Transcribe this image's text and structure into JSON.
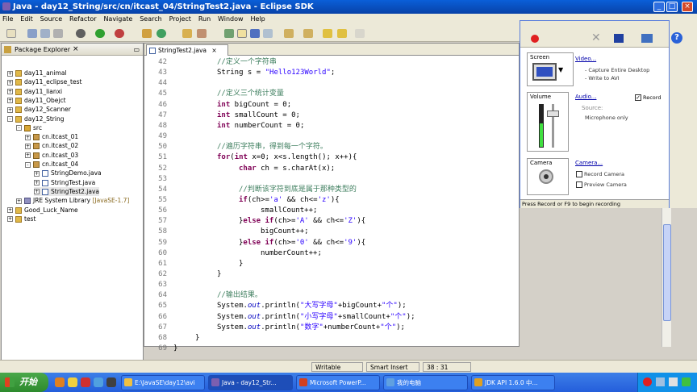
{
  "window": {
    "title": "Java - day12_String/src/cn/itcast_04/StringTest2.java - Eclipse SDK"
  },
  "menu": [
    "File",
    "Edit",
    "Source",
    "Refactor",
    "Navigate",
    "Search",
    "Project",
    "Run",
    "Window",
    "Help"
  ],
  "package_explorer": {
    "title": "Package Explorer",
    "items": [
      {
        "label": "day11_animal",
        "depth": 0,
        "exp": "+",
        "icon": "project"
      },
      {
        "label": "day11_eclipse_test",
        "depth": 0,
        "exp": "+",
        "icon": "project"
      },
      {
        "label": "day11_lianxi",
        "depth": 0,
        "exp": "+",
        "icon": "project"
      },
      {
        "label": "day11_Obejct",
        "depth": 0,
        "exp": "+",
        "icon": "project"
      },
      {
        "label": "day12_Scanner",
        "depth": 0,
        "exp": "+",
        "icon": "project"
      },
      {
        "label": "day12_String",
        "depth": 0,
        "exp": "-",
        "icon": "project"
      },
      {
        "label": "src",
        "depth": 1,
        "exp": "-",
        "icon": "src"
      },
      {
        "label": "cn.itcast_01",
        "depth": 2,
        "exp": "+",
        "icon": "package"
      },
      {
        "label": "cn.itcast_02",
        "depth": 2,
        "exp": "+",
        "icon": "package"
      },
      {
        "label": "cn.itcast_03",
        "depth": 2,
        "exp": "+",
        "icon": "package"
      },
      {
        "label": "cn.itcast_04",
        "depth": 2,
        "exp": "-",
        "icon": "package"
      },
      {
        "label": "StringDemo.java",
        "depth": 3,
        "exp": "+",
        "icon": "java"
      },
      {
        "label": "StringTest.java",
        "depth": 3,
        "exp": "+",
        "icon": "java"
      },
      {
        "label": "StringTest2.java",
        "depth": 3,
        "exp": "+",
        "icon": "java",
        "selected": true
      },
      {
        "label": "JRE System Library",
        "suffix": "[JavaSE-1.7]",
        "depth": 1,
        "exp": "+",
        "icon": "jre"
      },
      {
        "label": "Good_Luck_Name",
        "depth": 0,
        "exp": "+",
        "icon": "project"
      },
      {
        "label": "test",
        "depth": 0,
        "exp": "+",
        "icon": "project"
      }
    ]
  },
  "editor": {
    "tab": "StringTest2.java",
    "lines": [
      {
        "n": "42",
        "indent": 2,
        "parts": [
          [
            "cm",
            "//定义一个字符串"
          ]
        ]
      },
      {
        "n": "43",
        "indent": 2,
        "parts": [
          [
            "",
            "String s = "
          ],
          [
            "str",
            "\"Hello123World\""
          ],
          [
            "",
            ";"
          ]
        ]
      },
      {
        "n": "44",
        "indent": 0,
        "parts": []
      },
      {
        "n": "45",
        "indent": 2,
        "parts": [
          [
            "cm",
            "//定义三个统计变量"
          ]
        ]
      },
      {
        "n": "46",
        "indent": 2,
        "parts": [
          [
            "kw",
            "int"
          ],
          [
            "",
            " bigCount = 0;"
          ]
        ]
      },
      {
        "n": "47",
        "indent": 2,
        "parts": [
          [
            "kw",
            "int"
          ],
          [
            "",
            " smallCount = 0;"
          ]
        ]
      },
      {
        "n": "48",
        "indent": 2,
        "parts": [
          [
            "kw",
            "int"
          ],
          [
            "",
            " numberCount = 0;"
          ]
        ]
      },
      {
        "n": "49",
        "indent": 0,
        "parts": []
      },
      {
        "n": "50",
        "indent": 2,
        "parts": [
          [
            "cm",
            "//遍历字符串，得到每一个字符。"
          ]
        ]
      },
      {
        "n": "51",
        "indent": 2,
        "parts": [
          [
            "kw",
            "for"
          ],
          [
            "",
            "("
          ],
          [
            "kw",
            "int"
          ],
          [
            "",
            " x=0; x<s.length(); x++){"
          ]
        ]
      },
      {
        "n": "52",
        "indent": 3,
        "parts": [
          [
            "kw",
            "char"
          ],
          [
            "",
            " ch = s.charAt(x);"
          ]
        ]
      },
      {
        "n": "53",
        "indent": 0,
        "parts": []
      },
      {
        "n": "54",
        "indent": 3,
        "parts": [
          [
            "cm",
            "//判断该字符到底是属于那种类型的"
          ]
        ]
      },
      {
        "n": "55",
        "indent": 3,
        "parts": [
          [
            "kw",
            "if"
          ],
          [
            "",
            "(ch>="
          ],
          [
            "str",
            "'a'"
          ],
          [
            "",
            " && ch<="
          ],
          [
            "str",
            "'z'"
          ],
          [
            "",
            "){"
          ]
        ]
      },
      {
        "n": "56",
        "indent": 4,
        "parts": [
          [
            "",
            "smallCount++;"
          ]
        ]
      },
      {
        "n": "57",
        "indent": 3,
        "parts": [
          [
            "",
            "}"
          ],
          [
            "kw",
            "else if"
          ],
          [
            "",
            "(ch>="
          ],
          [
            "str",
            "'A'"
          ],
          [
            "",
            " && ch<="
          ],
          [
            "str",
            "'Z'"
          ],
          [
            "",
            "){"
          ]
        ]
      },
      {
        "n": "58",
        "indent": 4,
        "parts": [
          [
            "",
            "bigCount++;"
          ]
        ]
      },
      {
        "n": "59",
        "indent": 3,
        "parts": [
          [
            "",
            "}"
          ],
          [
            "kw",
            "else if"
          ],
          [
            "",
            "(ch>="
          ],
          [
            "str",
            "'0'"
          ],
          [
            "",
            " && ch<="
          ],
          [
            "str",
            "'9'"
          ],
          [
            "",
            "){"
          ]
        ]
      },
      {
        "n": "60",
        "indent": 4,
        "parts": [
          [
            "",
            "numberCount++;"
          ]
        ]
      },
      {
        "n": "61",
        "indent": 3,
        "parts": [
          [
            "",
            "}"
          ]
        ]
      },
      {
        "n": "62",
        "indent": 2,
        "parts": [
          [
            "",
            "}"
          ]
        ]
      },
      {
        "n": "63",
        "indent": 0,
        "parts": []
      },
      {
        "n": "64",
        "indent": 2,
        "parts": [
          [
            "cm",
            "//输出结果。"
          ]
        ]
      },
      {
        "n": "65",
        "indent": 2,
        "parts": [
          [
            "",
            "System."
          ],
          [
            "fld",
            "out"
          ],
          [
            "",
            ".println("
          ],
          [
            "str",
            "\"大写字母\""
          ],
          [
            "",
            "+bigCount+"
          ],
          [
            "str",
            "\"个\""
          ],
          [
            "",
            ");"
          ]
        ]
      },
      {
        "n": "66",
        "indent": 2,
        "parts": [
          [
            "",
            "System."
          ],
          [
            "fld",
            "out"
          ],
          [
            "",
            ".println("
          ],
          [
            "str",
            "\"小写字母\""
          ],
          [
            "",
            "+smallCount+"
          ],
          [
            "str",
            "\"个\""
          ],
          [
            "",
            ");"
          ]
        ]
      },
      {
        "n": "67",
        "indent": 2,
        "parts": [
          [
            "",
            "System."
          ],
          [
            "fld",
            "out"
          ],
          [
            "",
            ".println("
          ],
          [
            "str",
            "\"数字\""
          ],
          [
            "",
            "+numberCount+"
          ],
          [
            "str",
            "\"个\""
          ],
          [
            "",
            ");"
          ]
        ]
      },
      {
        "n": "68",
        "indent": 1,
        "parts": [
          [
            "",
            "}"
          ]
        ]
      },
      {
        "n": "69",
        "indent": 0,
        "parts": [
          [
            "",
            "}"
          ]
        ]
      }
    ]
  },
  "recorder": {
    "screen": {
      "title": "Screen",
      "link": "Video...",
      "opt1": "- Capture Entire Desktop",
      "opt2": "- Write to AVI"
    },
    "volume": {
      "title": "Volume",
      "link": "Audio...",
      "record_label": "Record",
      "source_label": "Source:",
      "source_value": "Microphone only"
    },
    "camera": {
      "title": "Camera",
      "link": "Camera...",
      "record_camera": "Record Camera",
      "preview_camera": "Preview Camera"
    },
    "status": "Press Record or F9 to begin recording"
  },
  "statusbar": {
    "mode": "Writable",
    "insert": "Smart Insert",
    "position": "38 : 31"
  },
  "taskbar": {
    "start": "开始",
    "tasks": [
      {
        "label": "E:\\JavaSE\\day12\\avi",
        "color": "#f0c040"
      },
      {
        "label": "Java - day12_Str...",
        "color": "#7b5fb0"
      },
      {
        "label": "Microsoft PowerP...",
        "color": "#d04020"
      },
      {
        "label": "我的电脑",
        "color": "#60a0e0"
      },
      {
        "label": "JDK API 1.6.0 中...",
        "color": "#e0a020"
      }
    ]
  }
}
